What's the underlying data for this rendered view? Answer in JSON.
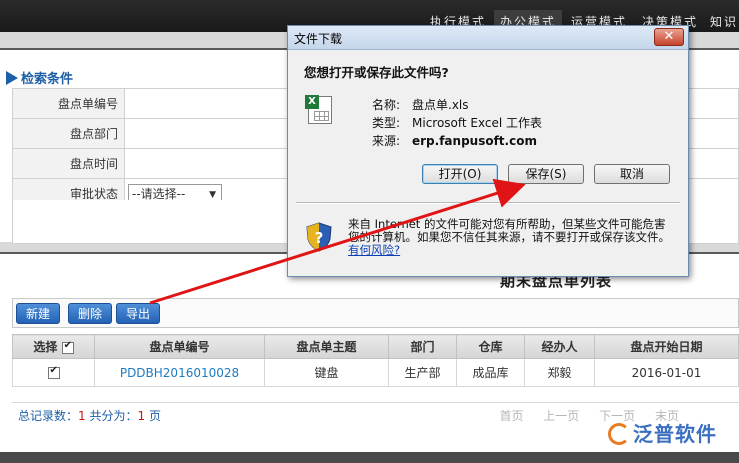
{
  "topbar": {
    "tabs": [
      {
        "label": "执行模式"
      },
      {
        "label": "办公模式"
      },
      {
        "label": "运营模式"
      },
      {
        "label": "决策模式"
      },
      {
        "label": "知识"
      }
    ]
  },
  "search": {
    "header": "检索条件",
    "fields": [
      {
        "label": "盘点单编号"
      },
      {
        "label": "盘点部门"
      },
      {
        "label": "盘点时间"
      },
      {
        "label": "审批状态",
        "value": "--请选择--"
      }
    ]
  },
  "grid": {
    "title": "期末盘点单列表",
    "buttons": {
      "add": "新建",
      "delete": "删除",
      "export": "导出"
    },
    "columns": [
      "选择",
      "盘点单编号",
      "盘点单主题",
      "部门",
      "仓库",
      "经办人",
      "盘点开始日期"
    ],
    "rows": [
      {
        "code": "PDDBH2016010028",
        "subject": "键盘",
        "dept": "生产部",
        "warehouse": "成品库",
        "handler": "郑毅",
        "start": "2016-01-01"
      }
    ],
    "paging": {
      "total_label": "总记录数：",
      "total": "1",
      "pages_label": "共分为：",
      "pages": "1",
      "pages_unit": "页",
      "first": "首页",
      "prev": "上一页",
      "next": "下一页",
      "last": "末页"
    }
  },
  "logo": {
    "text": "泛普软件"
  },
  "dialog": {
    "title": "文件下载",
    "close": "✕",
    "question": "您想打开或保存此文件吗?",
    "name_label": "名称:",
    "name_value": "盘点单.xls",
    "type_label": "类型:",
    "type_value": "Microsoft Excel 工作表",
    "source_label": "来源:",
    "source_value": "erp.fanpusoft.com",
    "btn_open": "打开(O)",
    "btn_save": "保存(S)",
    "btn_cancel": "取消",
    "warning": "来自 Internet 的文件可能对您有所帮助，但某些文件可能危害您的计算机。如果您不信任其来源，请不要打开或保存该文件。",
    "risk_link": "有何风险?"
  },
  "colors": {
    "accent": "#1d5fa8",
    "button_blue": "#2362b5",
    "arrow_red": "#e01414"
  }
}
